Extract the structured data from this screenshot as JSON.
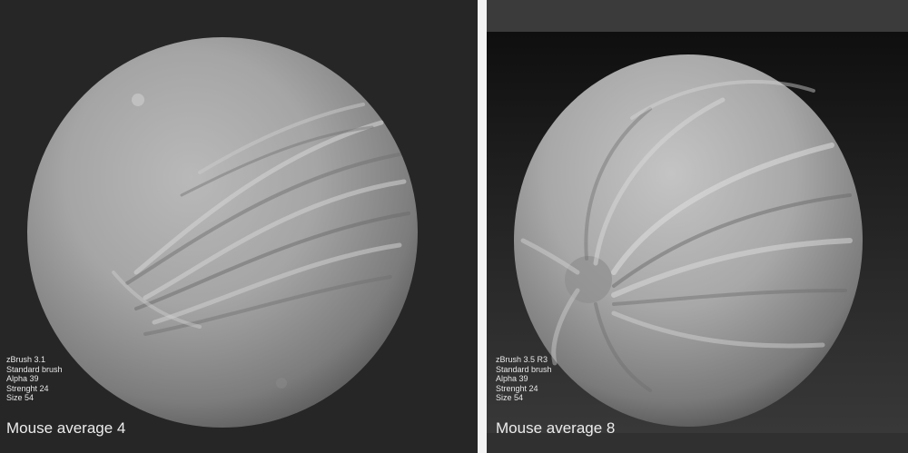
{
  "left": {
    "info_lines": [
      "zBrush 3.1",
      "Standard brush",
      "Alpha 39",
      "Strenght 24",
      "Size 54"
    ],
    "caption": "Mouse average 4"
  },
  "right": {
    "info_lines": [
      "zBrush 3.5 R3",
      "Standard brush",
      "Alpha 39",
      "Strenght 24",
      "Size 54"
    ],
    "caption": "Mouse average 8"
  }
}
